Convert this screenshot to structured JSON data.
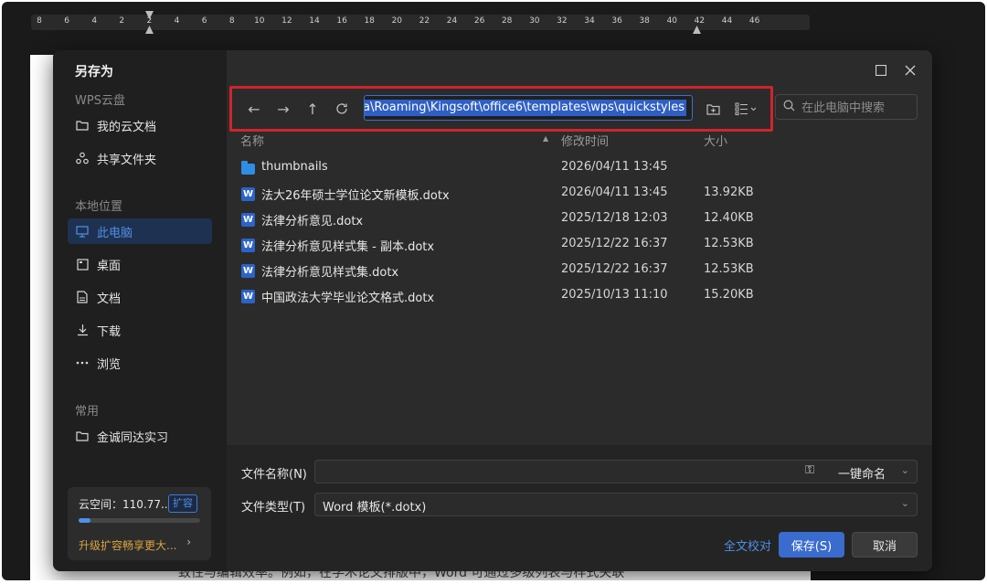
{
  "ruler": {
    "ticks": [
      "8",
      "6",
      "4",
      "2",
      "2",
      "4",
      "6",
      "8",
      "10",
      "12",
      "14",
      "16",
      "18",
      "20",
      "22",
      "24",
      "26",
      "28",
      "30",
      "32",
      "34",
      "36",
      "38",
      "40",
      "42",
      "44",
      "46"
    ]
  },
  "document": {
    "visible_text": "致性与编辑效率。例如，在学术论文排版中，Word 可通过多级列表与样式关联"
  },
  "dialog": {
    "title": "另存为",
    "sidebar": {
      "cloud_section": "WPS云盘",
      "cloud_items": [
        {
          "label": "我的云文档",
          "icon": "folder-icon"
        },
        {
          "label": "共享文件夹",
          "icon": "share-icon"
        }
      ],
      "local_section": "本地位置",
      "local_items": [
        {
          "label": "此电脑",
          "icon": "computer-icon",
          "active": true
        },
        {
          "label": "桌面",
          "icon": "desktop-icon"
        },
        {
          "label": "文档",
          "icon": "document-icon"
        },
        {
          "label": "下载",
          "icon": "download-icon"
        },
        {
          "label": "浏览",
          "icon": "more-icon"
        }
      ],
      "common_section": "常用",
      "common_items": [
        {
          "label": "金诚同达实习",
          "icon": "folder-icon"
        }
      ],
      "cloud_space": {
        "label": "云空间：110.77...",
        "expand_label": "扩容",
        "upgrade_label": "升级扩容畅享更大...",
        "used_fraction": 0.1
      }
    },
    "toolbar": {
      "path": "a\\Roaming\\Kingsoft\\office6\\templates\\wps\\quickstyles",
      "search_placeholder": "在此电脑中搜索"
    },
    "columns": {
      "name": "名称",
      "modified": "修改时间",
      "size": "大小"
    },
    "files": [
      {
        "name": "thumbnails",
        "date": "2026/04/11 13:45",
        "size": "",
        "type": "folder"
      },
      {
        "name": "法大26年硕士学位论文新模板.dotx",
        "date": "2026/04/11 13:45",
        "size": "13.92KB",
        "type": "word"
      },
      {
        "name": "法律分析意见.dotx",
        "date": "2025/12/18 12:03",
        "size": "12.40KB",
        "type": "word"
      },
      {
        "name": "法律分析意见样式集 - 副本.dotx",
        "date": "2025/12/22 16:37",
        "size": "12.53KB",
        "type": "word"
      },
      {
        "name": "法律分析意见样式集.dotx",
        "date": "2025/12/22 16:37",
        "size": "12.53KB",
        "type": "word"
      },
      {
        "name": "中国政法大学毕业论文格式.dotx",
        "date": "2025/10/13 11:10",
        "size": "15.20KB",
        "type": "word"
      }
    ],
    "filename_label": "文件名称(N)",
    "filename_value": "",
    "onekey_label": "一键命名",
    "filetype_label": "文件类型(T)",
    "filetype_value": "Word 模板(*.dotx)",
    "proofread_label": "全文校对",
    "save_label": "保存(S)",
    "cancel_label": "取消",
    "word_icon_letter": "W"
  },
  "colors": {
    "accent": "#4f8fe8",
    "highlight_box": "#d0242b",
    "upgrade": "#d9a441"
  }
}
